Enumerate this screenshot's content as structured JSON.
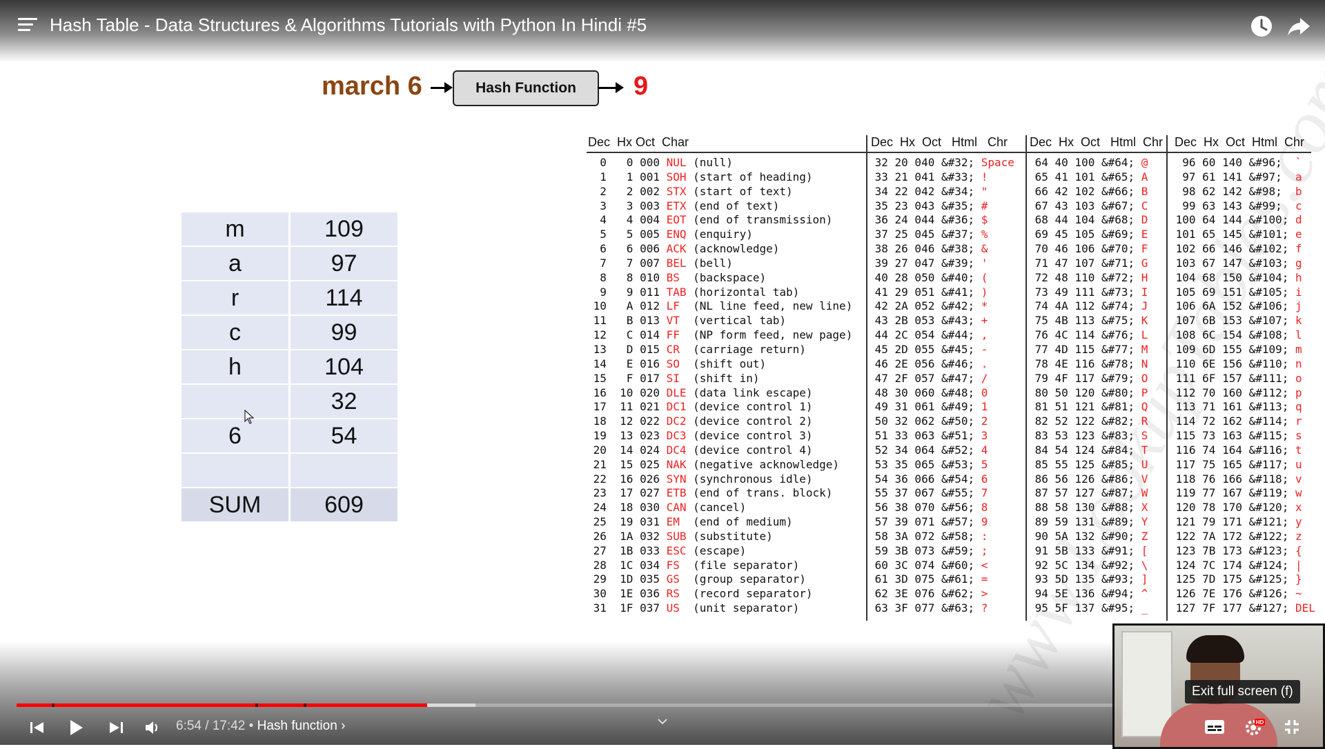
{
  "header": {
    "title": "Hash Table - Data Structures & Algorithms Tutorials with Python In Hindi #5",
    "icons": [
      "playlist-menu-icon",
      "watch-later-icon",
      "share-icon"
    ]
  },
  "slide": {
    "input": "march 6",
    "function_label": "Hash Function",
    "output": "9",
    "colors": {
      "input": "#8b4513",
      "output": "#e81818",
      "table_cell": "#e3e7f3"
    },
    "char_table": [
      {
        "char": "m",
        "code": "109"
      },
      {
        "char": "a",
        "code": "97"
      },
      {
        "char": "r",
        "code": "114"
      },
      {
        "char": "c",
        "code": "99"
      },
      {
        "char": "h",
        "code": "104"
      },
      {
        "char": "",
        "code": "32"
      },
      {
        "char": "6",
        "code": "54"
      },
      {
        "char": "",
        "code": ""
      }
    ],
    "sum_label": "SUM",
    "sum_value": "609"
  },
  "ascii_table": {
    "headers": [
      "Dec  Hx Oct  Char",
      "Dec  Hx  Oct   Html   Chr",
      "Dec  Hx  Oct   Html  Chr",
      "Dec  Hx  Oct  Html  Chr"
    ],
    "col1": [
      [
        "  0   0 000 ",
        "NUL",
        " (null)"
      ],
      [
        "  1   1 001 ",
        "SOH",
        " (start of heading)"
      ],
      [
        "  2   2 002 ",
        "STX",
        " (start of text)"
      ],
      [
        "  3   3 003 ",
        "ETX",
        " (end of text)"
      ],
      [
        "  4   4 004 ",
        "EOT",
        " (end of transmission)"
      ],
      [
        "  5   5 005 ",
        "ENQ",
        " (enquiry)"
      ],
      [
        "  6   6 006 ",
        "ACK",
        " (acknowledge)"
      ],
      [
        "  7   7 007 ",
        "BEL",
        " (bell)"
      ],
      [
        "  8   8 010 ",
        "BS ",
        " (backspace)"
      ],
      [
        "  9   9 011 ",
        "TAB",
        " (horizontal tab)"
      ],
      [
        " 10   A 012 ",
        "LF ",
        " (NL line feed, new line)"
      ],
      [
        " 11   B 013 ",
        "VT ",
        " (vertical tab)"
      ],
      [
        " 12   C 014 ",
        "FF ",
        " (NP form feed, new page)"
      ],
      [
        " 13   D 015 ",
        "CR ",
        " (carriage return)"
      ],
      [
        " 14   E 016 ",
        "SO ",
        " (shift out)"
      ],
      [
        " 15   F 017 ",
        "SI ",
        " (shift in)"
      ],
      [
        " 16  10 020 ",
        "DLE",
        " (data link escape)"
      ],
      [
        " 17  11 021 ",
        "DC1",
        " (device control 1)"
      ],
      [
        " 18  12 022 ",
        "DC2",
        " (device control 2)"
      ],
      [
        " 19  13 023 ",
        "DC3",
        " (device control 3)"
      ],
      [
        " 20  14 024 ",
        "DC4",
        " (device control 4)"
      ],
      [
        " 21  15 025 ",
        "NAK",
        " (negative acknowledge)"
      ],
      [
        " 22  16 026 ",
        "SYN",
        " (synchronous idle)"
      ],
      [
        " 23  17 027 ",
        "ETB",
        " (end of trans. block)"
      ],
      [
        " 24  18 030 ",
        "CAN",
        " (cancel)"
      ],
      [
        " 25  19 031 ",
        "EM ",
        " (end of medium)"
      ],
      [
        " 26  1A 032 ",
        "SUB",
        " (substitute)"
      ],
      [
        " 27  1B 033 ",
        "ESC",
        " (escape)"
      ],
      [
        " 28  1C 034 ",
        "FS ",
        " (file separator)"
      ],
      [
        " 29  1D 035 ",
        "GS ",
        " (group separator)"
      ],
      [
        " 30  1E 036 ",
        "RS ",
        " (record separator)"
      ],
      [
        " 31  1F 037 ",
        "US ",
        " (unit separator)"
      ]
    ],
    "col2": [
      [
        " 32 20 040 &#32; ",
        "Space"
      ],
      [
        " 33 21 041 &#33; ",
        "!"
      ],
      [
        " 34 22 042 &#34; ",
        "\""
      ],
      [
        " 35 23 043 &#35; ",
        "#"
      ],
      [
        " 36 24 044 &#36; ",
        "$"
      ],
      [
        " 37 25 045 &#37; ",
        "%"
      ],
      [
        " 38 26 046 &#38; ",
        "&"
      ],
      [
        " 39 27 047 &#39; ",
        "'"
      ],
      [
        " 40 28 050 &#40; ",
        "("
      ],
      [
        " 41 29 051 &#41; ",
        ")"
      ],
      [
        " 42 2A 052 &#42; ",
        "*"
      ],
      [
        " 43 2B 053 &#43; ",
        "+"
      ],
      [
        " 44 2C 054 &#44; ",
        ","
      ],
      [
        " 45 2D 055 &#45; ",
        "-"
      ],
      [
        " 46 2E 056 &#46; ",
        "."
      ],
      [
        " 47 2F 057 &#47; ",
        "/"
      ],
      [
        " 48 30 060 &#48; ",
        "0"
      ],
      [
        " 49 31 061 &#49; ",
        "1"
      ],
      [
        " 50 32 062 &#50; ",
        "2"
      ],
      [
        " 51 33 063 &#51; ",
        "3"
      ],
      [
        " 52 34 064 &#52; ",
        "4"
      ],
      [
        " 53 35 065 &#53; ",
        "5"
      ],
      [
        " 54 36 066 &#54; ",
        "6"
      ],
      [
        " 55 37 067 &#55; ",
        "7"
      ],
      [
        " 56 38 070 &#56; ",
        "8"
      ],
      [
        " 57 39 071 &#57; ",
        "9"
      ],
      [
        " 58 3A 072 &#58; ",
        ":"
      ],
      [
        " 59 3B 073 &#59; ",
        ";"
      ],
      [
        " 60 3C 074 &#60; ",
        "<"
      ],
      [
        " 61 3D 075 &#61; ",
        "="
      ],
      [
        " 62 3E 076 &#62; ",
        ">"
      ],
      [
        " 63 3F 077 &#63; ",
        "?"
      ]
    ],
    "col3": [
      [
        " 64 40 100 &#64; ",
        "@"
      ],
      [
        " 65 41 101 &#65; ",
        "A"
      ],
      [
        " 66 42 102 &#66; ",
        "B"
      ],
      [
        " 67 43 103 &#67; ",
        "C"
      ],
      [
        " 68 44 104 &#68; ",
        "D"
      ],
      [
        " 69 45 105 &#69; ",
        "E"
      ],
      [
        " 70 46 106 &#70; ",
        "F"
      ],
      [
        " 71 47 107 &#71; ",
        "G"
      ],
      [
        " 72 48 110 &#72; ",
        "H"
      ],
      [
        " 73 49 111 &#73; ",
        "I"
      ],
      [
        " 74 4A 112 &#74; ",
        "J"
      ],
      [
        " 75 4B 113 &#75; ",
        "K"
      ],
      [
        " 76 4C 114 &#76; ",
        "L"
      ],
      [
        " 77 4D 115 &#77; ",
        "M"
      ],
      [
        " 78 4E 116 &#78; ",
        "N"
      ],
      [
        " 79 4F 117 &#79; ",
        "O"
      ],
      [
        " 80 50 120 &#80; ",
        "P"
      ],
      [
        " 81 51 121 &#81; ",
        "Q"
      ],
      [
        " 82 52 122 &#82; ",
        "R"
      ],
      [
        " 83 53 123 &#83; ",
        "S"
      ],
      [
        " 84 54 124 &#84; ",
        "T"
      ],
      [
        " 85 55 125 &#85; ",
        "U"
      ],
      [
        " 86 56 126 &#86; ",
        "V"
      ],
      [
        " 87 57 127 &#87; ",
        "W"
      ],
      [
        " 88 58 130 &#88; ",
        "X"
      ],
      [
        " 89 59 131 &#89; ",
        "Y"
      ],
      [
        " 90 5A 132 &#90; ",
        "Z"
      ],
      [
        " 91 5B 133 &#91; ",
        "["
      ],
      [
        " 92 5C 134 &#92; ",
        "\\"
      ],
      [
        " 93 5D 135 &#93; ",
        "]"
      ],
      [
        " 94 5E 136 &#94; ",
        "^"
      ],
      [
        " 95 5F 137 &#95; ",
        "_"
      ]
    ],
    "col4": [
      [
        "  96 60 140 &#96;  ",
        "`"
      ],
      [
        "  97 61 141 &#97;  ",
        "a"
      ],
      [
        "  98 62 142 &#98;  ",
        "b"
      ],
      [
        "  99 63 143 &#99;  ",
        "c"
      ],
      [
        " 100 64 144 &#100; ",
        "d"
      ],
      [
        " 101 65 145 &#101; ",
        "e"
      ],
      [
        " 102 66 146 &#102; ",
        "f"
      ],
      [
        " 103 67 147 &#103; ",
        "g"
      ],
      [
        " 104 68 150 &#104; ",
        "h"
      ],
      [
        " 105 69 151 &#105; ",
        "i"
      ],
      [
        " 106 6A 152 &#106; ",
        "j"
      ],
      [
        " 107 6B 153 &#107; ",
        "k"
      ],
      [
        " 108 6C 154 &#108; ",
        "l"
      ],
      [
        " 109 6D 155 &#109; ",
        "m"
      ],
      [
        " 110 6E 156 &#110; ",
        "n"
      ],
      [
        " 111 6F 157 &#111; ",
        "o"
      ],
      [
        " 112 70 160 &#112; ",
        "p"
      ],
      [
        " 113 71 161 &#113; ",
        "q"
      ],
      [
        " 114 72 162 &#114; ",
        "r"
      ],
      [
        " 115 73 163 &#115; ",
        "s"
      ],
      [
        " 116 74 164 &#116; ",
        "t"
      ],
      [
        " 117 75 165 &#117; ",
        "u"
      ],
      [
        " 118 76 166 &#118; ",
        "v"
      ],
      [
        " 119 77 167 &#119; ",
        "w"
      ],
      [
        " 120 78 170 &#120; ",
        "x"
      ],
      [
        " 121 79 171 &#121; ",
        "y"
      ],
      [
        " 122 7A 172 &#122; ",
        "z"
      ],
      [
        " 123 7B 173 &#123; ",
        "{"
      ],
      [
        " 124 7C 174 &#124; ",
        "|"
      ],
      [
        " 125 7D 175 &#125; ",
        "}"
      ],
      [
        " 126 7E 176 &#126; ",
        "~"
      ],
      [
        " 127 7F 177 &#127; ",
        "DEL"
      ]
    ]
  },
  "player": {
    "time_current": "6:54",
    "time_total": "17:42",
    "time_separator": " / ",
    "chapter_prefix": " • ",
    "chapter": "Hash function",
    "chapter_chevron": "›",
    "progress_played_fraction": 0.318,
    "progress_buffered_fraction": 0.355,
    "chapter_marks": [
      0.027,
      0.185,
      0.222
    ],
    "colors": {
      "played": "#ff0000"
    },
    "tooltip": "Exit full screen (f)",
    "controls": [
      "previous-icon",
      "play-icon",
      "next-icon",
      "volume-icon",
      "chapters-chevron-icon",
      "subtitles-icon",
      "settings-icon",
      "exit-fullscreen-icon"
    ]
  }
}
